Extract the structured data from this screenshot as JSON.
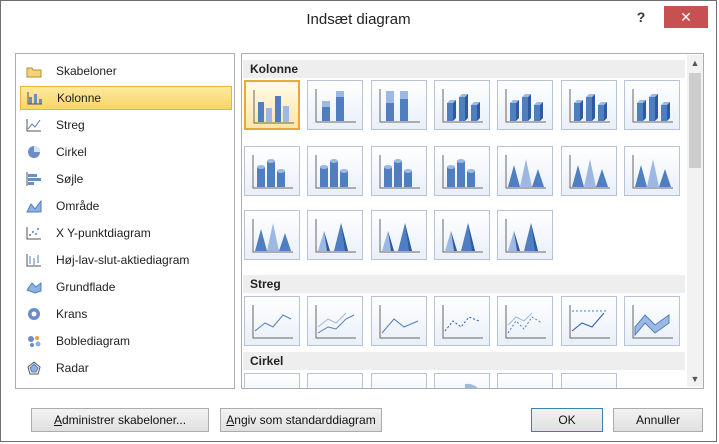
{
  "window": {
    "title": "Indsæt diagram",
    "help_label": "?",
    "close_label": "✕"
  },
  "categories": [
    {
      "label": "Skabeloner",
      "icon": "folder-icon",
      "selected": false
    },
    {
      "label": "Kolonne",
      "icon": "column-chart-icon",
      "selected": true
    },
    {
      "label": "Streg",
      "icon": "line-chart-icon",
      "selected": false
    },
    {
      "label": "Cirkel",
      "icon": "pie-chart-icon",
      "selected": false
    },
    {
      "label": "Søjle",
      "icon": "bar-chart-icon",
      "selected": false
    },
    {
      "label": "Område",
      "icon": "area-chart-icon",
      "selected": false
    },
    {
      "label": "X Y-punktdiagram",
      "icon": "scatter-chart-icon",
      "selected": false
    },
    {
      "label": "Høj-lav-slut-aktiediagram",
      "icon": "stock-chart-icon",
      "selected": false
    },
    {
      "label": "Grundflade",
      "icon": "surface-chart-icon",
      "selected": false
    },
    {
      "label": "Krans",
      "icon": "doughnut-chart-icon",
      "selected": false
    },
    {
      "label": "Boblediagram",
      "icon": "bubble-chart-icon",
      "selected": false
    },
    {
      "label": "Radar",
      "icon": "radar-chart-icon",
      "selected": false
    }
  ],
  "sections": {
    "kolonne": {
      "title": "Kolonne"
    },
    "streg": {
      "title": "Streg"
    },
    "cirkel": {
      "title": "Cirkel"
    }
  },
  "colors": {
    "accent_selected": "#f9d565",
    "chart_blue": "#4f7fc0",
    "close_red": "#c75050"
  },
  "buttons": {
    "manage_templates": {
      "accel": "A",
      "rest": "dministrer skabeloner..."
    },
    "set_default": {
      "accel": "A",
      "rest": "ngiv som standarddiagram"
    },
    "ok": "OK",
    "cancel": "Annuller"
  },
  "scrollbar": {
    "up": "▲",
    "down": "▼"
  }
}
